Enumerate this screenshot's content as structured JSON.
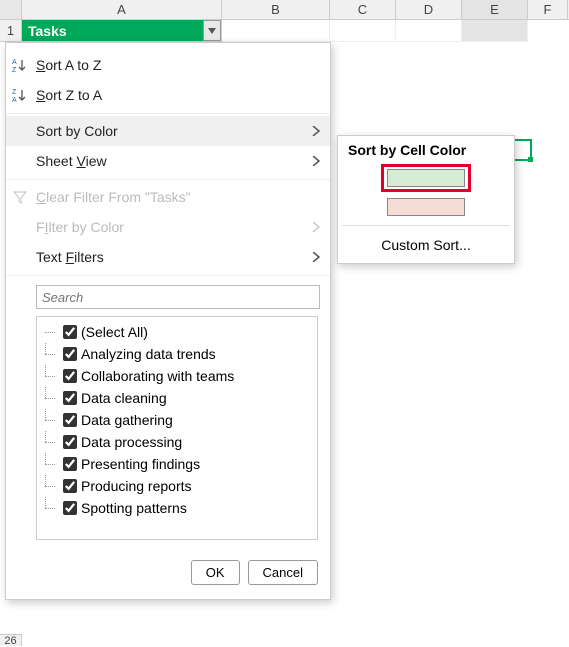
{
  "columns": [
    "A",
    "B",
    "C",
    "D",
    "E",
    "F"
  ],
  "row1_number": "1",
  "bottom_row_number": "26",
  "cell_A1": "Tasks",
  "menu": {
    "sort_az": "ort A to Z",
    "sort_za": "ort Z to A",
    "sort_by_color": "Sort by Color",
    "sheet_view": "Sheet ",
    "sheet_view2": "iew",
    "clear_filter": "lear Filter From \"Tasks\"",
    "filter_by_color": "Filter by Color",
    "text_filters": "Text ",
    "text_filters2": "ilters"
  },
  "sort_az_prefix": "S",
  "sort_za_prefix": "S",
  "sheet_view_u": "V",
  "clear_u": "C",
  "filter_u": "I",
  "filters_u": "F",
  "search_placeholder": "Search",
  "checklist": [
    "(Select All)",
    "Analyzing data trends",
    "Collaborating with teams",
    "Data cleaning",
    "Data gathering",
    "Data processing",
    "Presenting findings",
    "Producing reports",
    "Spotting patterns"
  ],
  "buttons": {
    "ok": "OK",
    "cancel": "Cancel"
  },
  "submenu": {
    "title": "Sort by Cell Color",
    "custom": "Custom Sort...",
    "swatches": {
      "green": "#d4edd4",
      "pink": "#f6dcd6"
    }
  }
}
